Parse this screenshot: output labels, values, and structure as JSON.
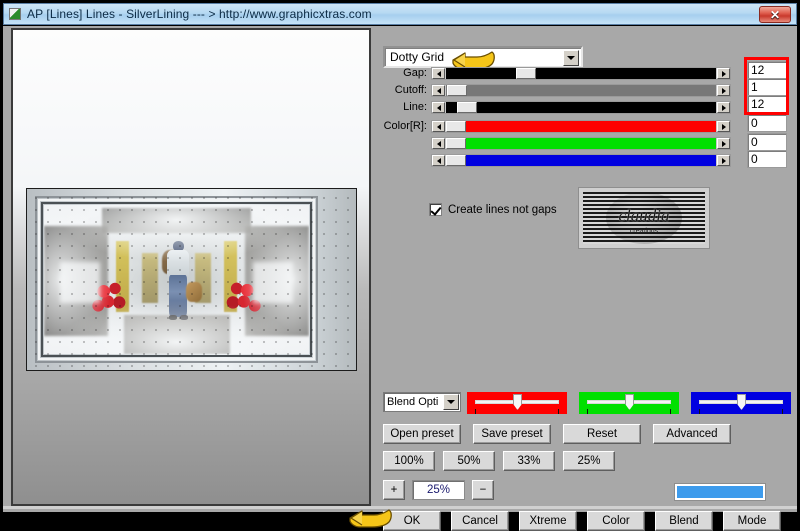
{
  "window": {
    "title": "AP [Lines]  Lines - SilverLining   --- > http://www.graphicxtras.com",
    "close_label": "✕",
    "app_icon": "app-icon"
  },
  "preset": {
    "selected": "Dotty Grid",
    "dropdown_icon": "chevron-down-icon"
  },
  "sliders": [
    {
      "label": "Gap:",
      "value": "12",
      "thumb_pct": 30,
      "track_color": "#000000",
      "name": "gap"
    },
    {
      "label": "Cutoff:",
      "value": "1",
      "thumb_pct": 1,
      "track_color": "#787878",
      "name": "cutoff"
    },
    {
      "label": "Line:",
      "value": "12",
      "thumb_pct": 5,
      "track_color": "#000000",
      "name": "line"
    },
    {
      "label": "Color[R]:",
      "value": "0",
      "thumb_pct": 0,
      "track_color": "#ff0000",
      "name": "color-r"
    },
    {
      "label": "",
      "value": "0",
      "thumb_pct": 0,
      "track_color": "#00e000",
      "name": "color-g"
    },
    {
      "label": "",
      "value": "0",
      "thumb_pct": 0,
      "track_color": "#0000e0",
      "name": "color-b"
    }
  ],
  "checkbox": {
    "label": "Create lines not gaps",
    "checked": true
  },
  "watermark": {
    "text": "claudia",
    "subtext": "creations"
  },
  "blend": {
    "selected": "Blend Opti",
    "dropdown_icon": "chevron-down-icon"
  },
  "rgb_trackbars": [
    {
      "name": "red-trackbar",
      "color": "#ff0000",
      "thumb_pct": 50
    },
    {
      "name": "green-trackbar",
      "color": "#00e000",
      "thumb_pct": 50
    },
    {
      "name": "blue-trackbar",
      "color": "#0000e0",
      "thumb_pct": 50
    }
  ],
  "preset_buttons": [
    {
      "label": "Open preset",
      "name": "open-preset-button"
    },
    {
      "label": "Save preset",
      "name": "save-preset-button"
    },
    {
      "label": "Reset",
      "name": "reset-button"
    },
    {
      "label": "Advanced",
      "name": "advanced-button"
    }
  ],
  "zoom_buttons": [
    {
      "label": "100%",
      "name": "zoom-100-button"
    },
    {
      "label": "50%",
      "name": "zoom-50-button"
    },
    {
      "label": "33%",
      "name": "zoom-33-button"
    },
    {
      "label": "25%",
      "name": "zoom-25-button"
    }
  ],
  "zoom_stepper": {
    "plus": "+",
    "value": "25%",
    "minus": "−"
  },
  "swatch_color": "#3d9bec",
  "action_buttons": [
    {
      "label": "OK",
      "name": "ok-button"
    },
    {
      "label": "Cancel",
      "name": "cancel-button"
    },
    {
      "label": "Xtreme",
      "name": "xtreme-button"
    },
    {
      "label": "Color",
      "name": "color-button"
    },
    {
      "label": "Blend",
      "name": "blend-button"
    },
    {
      "label": "Mode",
      "name": "mode-button"
    }
  ],
  "annotations": {
    "hand_top": "pointing-hand-icon",
    "hand_bottom": "pointing-hand-icon",
    "red_highlight": "#ff0000"
  }
}
